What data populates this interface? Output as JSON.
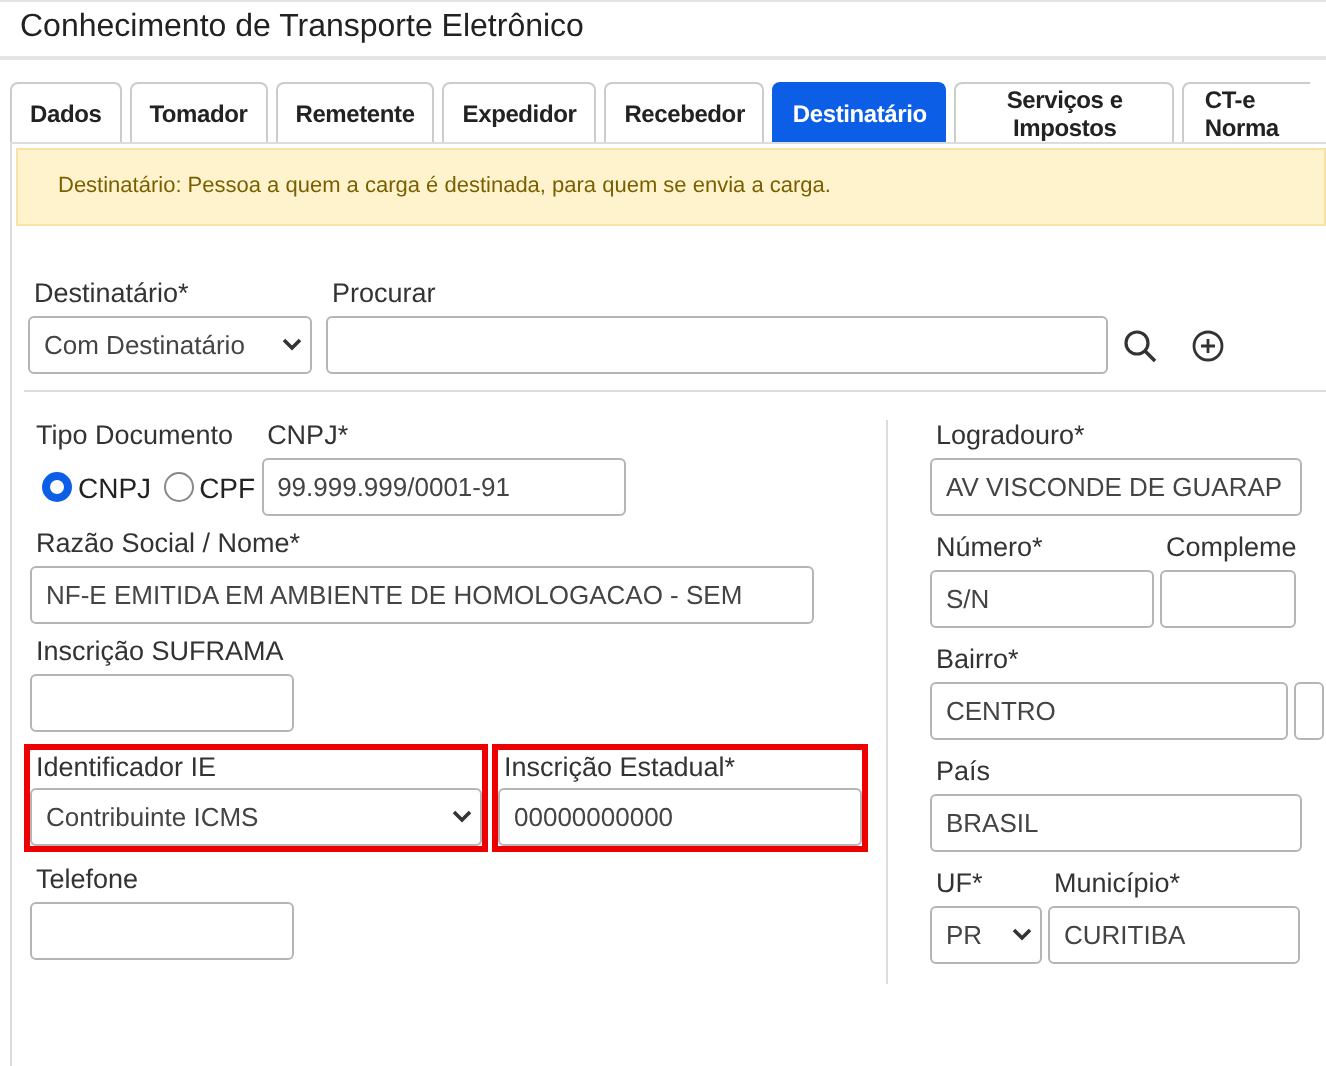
{
  "window": {
    "title": "Conhecimento de Transporte Eletrônico"
  },
  "tabs": [
    {
      "label": "Dados",
      "selected": false
    },
    {
      "label": "Tomador",
      "selected": false
    },
    {
      "label": "Remetente",
      "selected": false
    },
    {
      "label": "Expedidor",
      "selected": false
    },
    {
      "label": "Recebedor",
      "selected": false
    },
    {
      "label": "Destinatário",
      "selected": true
    },
    {
      "label": "Serviços e Impostos",
      "selected": false
    },
    {
      "label": "CT-e Norma",
      "selected": false
    }
  ],
  "alert": {
    "text": "Destinatário: Pessoa a quem a carga é destinada, para quem se envia a carga."
  },
  "destinatario": {
    "label": "Destinatário*",
    "value": "Com Destinatário"
  },
  "search": {
    "label": "Procurar"
  },
  "left_column": [
    [
      {
        "kind": "radio",
        "label": "Tipo Documento",
        "options": [
          {
            "label": "CNPJ",
            "selected": true
          },
          {
            "label": "CPF",
            "selected": false
          }
        ]
      },
      {
        "kind": "input",
        "label": "CNPJ*",
        "value": "99.999.999/0001-91",
        "highlighted": false
      }
    ],
    [
      {
        "kind": "input",
        "label": "Razão Social / Nome*",
        "value": "NF-E EMITIDA EM AMBIENTE DE HOMOLOGACAO - SEM",
        "highlighted": false
      }
    ],
    [
      {
        "kind": "input",
        "label": "Inscrição SUFRAMA",
        "highlighted": false
      }
    ],
    [
      {
        "kind": "select",
        "label": "Identificador IE",
        "value": "Contribuinte ICMS",
        "highlighted": true
      },
      {
        "kind": "input",
        "label": "Inscrição Estadual*",
        "value": "00000000000",
        "highlighted": true
      }
    ],
    [
      {
        "kind": "input",
        "label": "Telefone",
        "highlighted": false
      }
    ]
  ],
  "right_column": [
    [
      {
        "kind": "input",
        "label": "Logradouro*",
        "value": "AV VISCONDE DE GUARAP",
        "highlighted": false
      }
    ],
    [
      {
        "kind": "input",
        "label": "Número*",
        "value": "S/N",
        "highlighted": false
      },
      {
        "kind": "input",
        "label": "Compleme",
        "highlighted": false
      }
    ],
    [
      {
        "kind": "input",
        "label": "Bairro*",
        "value": "CENTRO",
        "highlighted": false
      },
      {
        "kind": "input",
        "highlighted": false
      }
    ],
    [
      {
        "kind": "input",
        "label": "País",
        "value": "BRASIL",
        "highlighted": false
      }
    ],
    [
      {
        "kind": "select",
        "label": "UF*",
        "value": "PR",
        "highlighted": false
      },
      {
        "kind": "input",
        "label": "Município*",
        "value": "CURITIBA",
        "highlighted": false
      }
    ]
  ]
}
